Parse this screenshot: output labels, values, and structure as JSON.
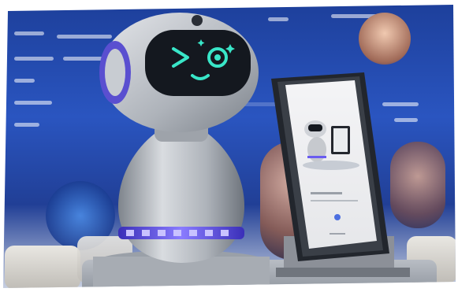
{
  "scene": {
    "subject": "robot",
    "robot_face": {
      "left_eye": "chevron",
      "right_eye": "circle",
      "mouth": "smile"
    },
    "colors": {
      "background_blue": "#2a55c0",
      "robot_body": "#c9ccd1",
      "face_screen": "#14181f",
      "face_glow": "#39e6c8",
      "waist_ring": "#6a5cf0"
    }
  }
}
